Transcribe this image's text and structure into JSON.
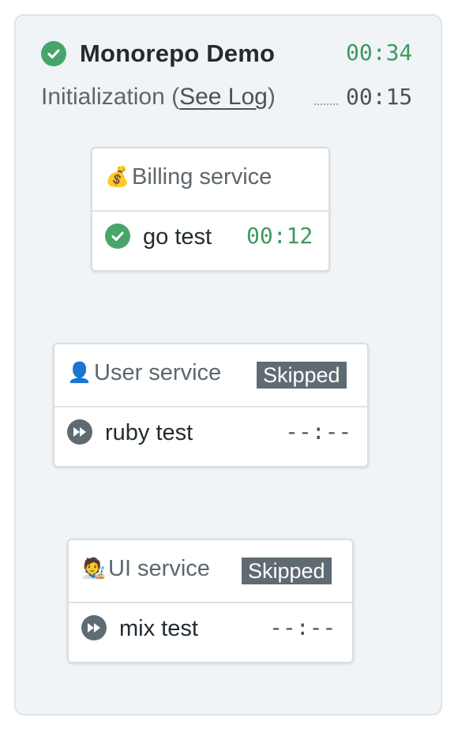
{
  "pipeline": {
    "name": "Monorepo Demo",
    "duration": "00:34",
    "status": "passed",
    "status_color": "#48a56a",
    "init": {
      "label_prefix": "Initialization (",
      "link": "See Log",
      "label_suffix": ")",
      "duration": "00:15"
    }
  },
  "blocks": [
    {
      "icon": "money-bag-icon",
      "emoji": "💰",
      "name": "Billing service",
      "badge": "",
      "job": {
        "name": "go test",
        "duration": "00:12",
        "status": "passed"
      }
    },
    {
      "icon": "bust-in-silhouette-icon",
      "emoji": "👤",
      "name": "User service",
      "badge": "Skipped",
      "job": {
        "name": "ruby test",
        "duration": "--:--",
        "status": "skipped"
      }
    },
    {
      "icon": "artist-icon",
      "emoji": "🧑‍🎨",
      "name": "UI service",
      "badge": "Skipped",
      "job": {
        "name": "mix test",
        "duration": "--:--",
        "status": "skipped"
      }
    }
  ],
  "colors": {
    "passed": "#48a56a",
    "skipped": "#5f6b72",
    "background": "#f1f4f6"
  }
}
